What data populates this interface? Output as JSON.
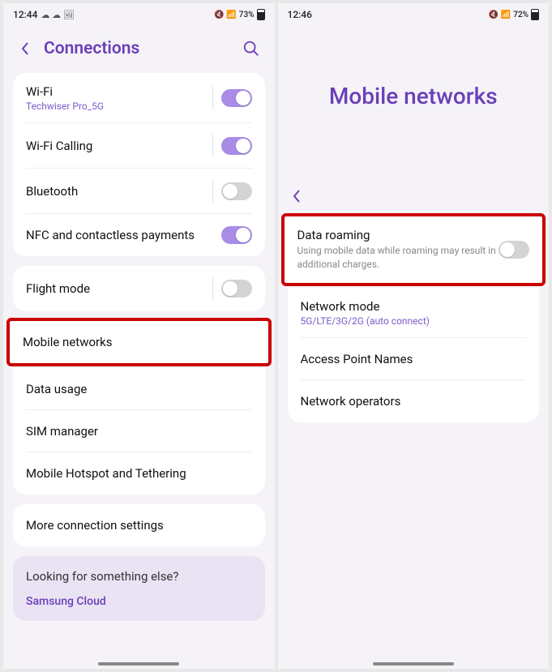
{
  "screen1": {
    "status": {
      "time": "12:44",
      "battery": "73%"
    },
    "header": {
      "title": "Connections"
    },
    "group1": [
      {
        "label": "Wi-Fi",
        "sub": "Techwiser Pro_5G",
        "toggle": true,
        "divider": true
      },
      {
        "label": "Wi-Fi Calling",
        "toggle": true,
        "divider": true
      },
      {
        "label": "Bluetooth",
        "toggle": false,
        "divider": true
      },
      {
        "label": "NFC and contactless payments",
        "toggle": true,
        "divider": false
      }
    ],
    "group2": [
      {
        "label": "Flight mode",
        "toggle": false,
        "divider": true
      }
    ],
    "highlighted": {
      "label": "Mobile networks"
    },
    "group3": [
      {
        "label": "Data usage"
      },
      {
        "label": "SIM manager"
      },
      {
        "label": "Mobile Hotspot and Tethering"
      }
    ],
    "group4": [
      {
        "label": "More connection settings"
      }
    ],
    "hint": {
      "title": "Looking for something else?",
      "link": "Samsung Cloud"
    }
  },
  "screen2": {
    "status": {
      "time": "12:46",
      "battery": "72%"
    },
    "title": "Mobile networks",
    "highlighted": {
      "label": "Data roaming",
      "sub": "Using mobile data while roaming may result in additional charges.",
      "toggle": false
    },
    "items": [
      {
        "label": "Network mode",
        "sub": "5G/LTE/3G/2G (auto connect)"
      },
      {
        "label": "Access Point Names"
      },
      {
        "label": "Network operators"
      }
    ]
  }
}
